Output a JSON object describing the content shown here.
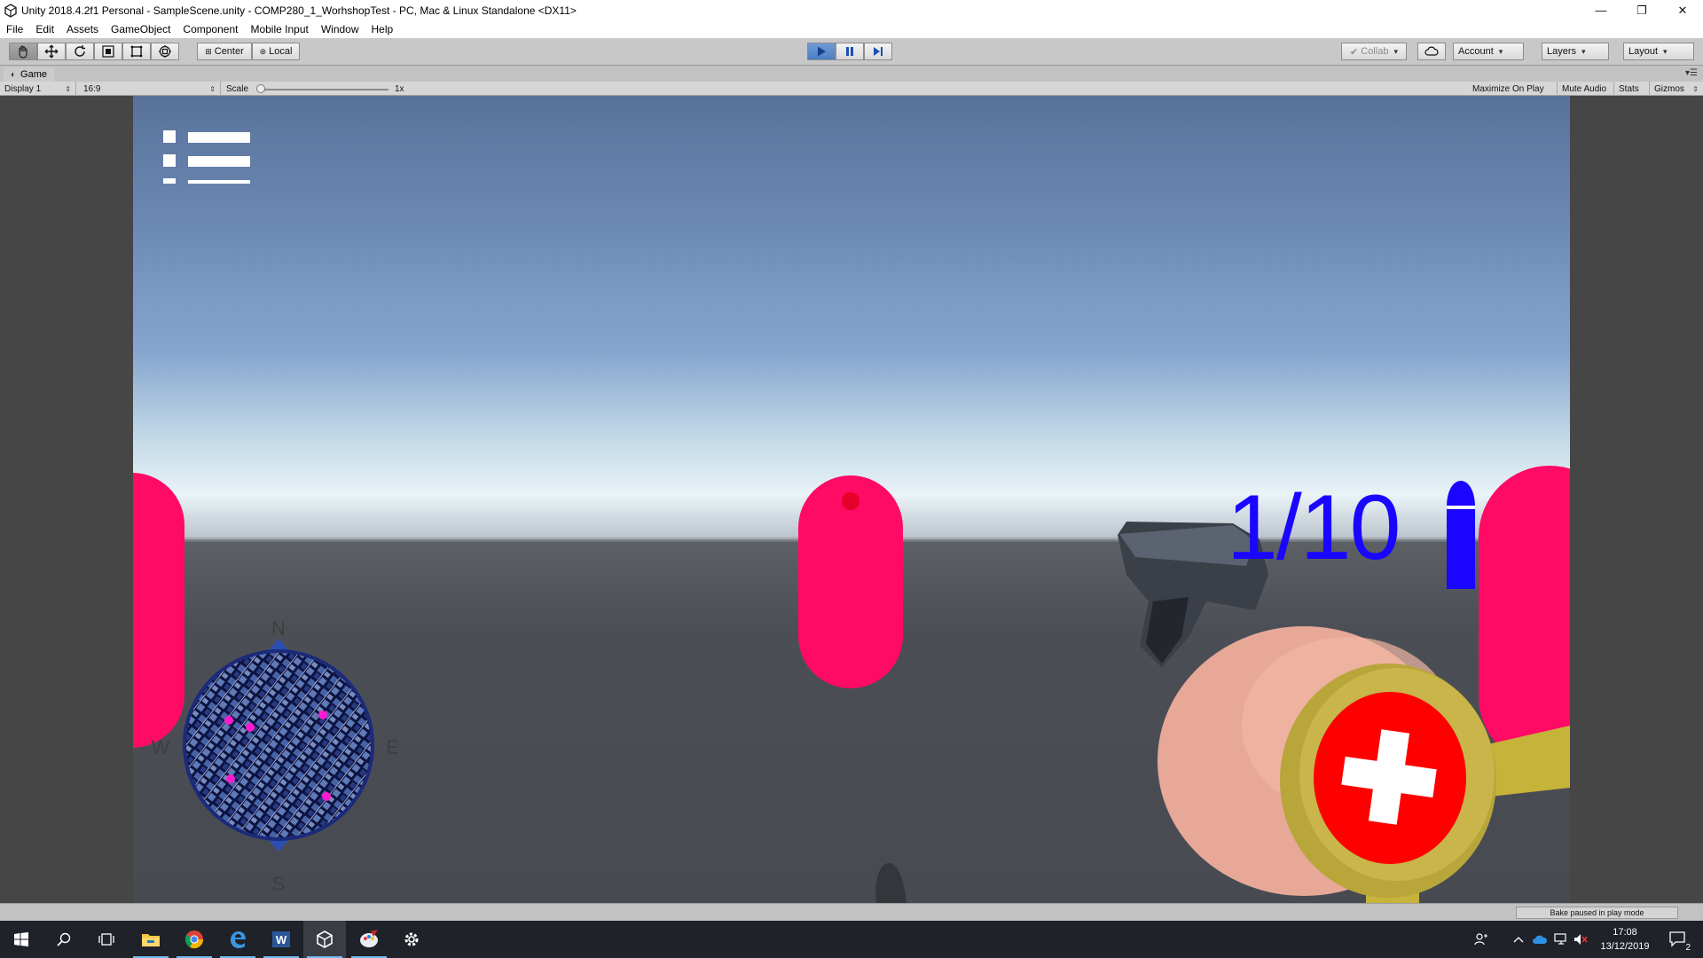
{
  "window": {
    "title": "Unity 2018.4.2f1 Personal - SampleScene.unity - COMP280_1_WorhshopTest - PC, Mac & Linux Standalone <DX11>",
    "minimize": "—",
    "restore": "❐",
    "close": "✕"
  },
  "menubar": {
    "items": [
      "File",
      "Edit",
      "Assets",
      "GameObject",
      "Component",
      "Mobile Input",
      "Window",
      "Help"
    ]
  },
  "toolbar": {
    "pivot_label": "Center",
    "space_label": "Local",
    "collab_label": "Collab",
    "account_label": "Account",
    "layers_label": "Layers",
    "layout_label": "Layout",
    "play_state": "playing"
  },
  "game_panel": {
    "tab_label": "Game",
    "display": "Display 1",
    "aspect": "16:9",
    "scale_label": "Scale",
    "scale_value": "1x",
    "maximize_on_play": "Maximize On Play",
    "mute_audio": "Mute Audio",
    "stats": "Stats",
    "gizmos": "Gizmos"
  },
  "hud": {
    "ammo": "1/10",
    "compass": {
      "n": "N",
      "s": "S",
      "e": "E",
      "w": "W"
    },
    "minimap_markers": 5
  },
  "status": {
    "bake": "Bake paused in play mode"
  },
  "taskbar": {
    "time": "17:08",
    "date": "13/12/2019",
    "notification_count": "2",
    "apps": [
      "start-icon",
      "search-icon",
      "task-view-icon",
      "file-explorer-icon",
      "chrome-icon",
      "edge-icon",
      "word-icon",
      "unity-icon",
      "paint-icon",
      "settings-icon"
    ]
  },
  "colors": {
    "capsule": "#ff0a64",
    "ammo": "#1a06ff",
    "health_red": "#ff0000",
    "health_gold": "#c6b33a"
  }
}
